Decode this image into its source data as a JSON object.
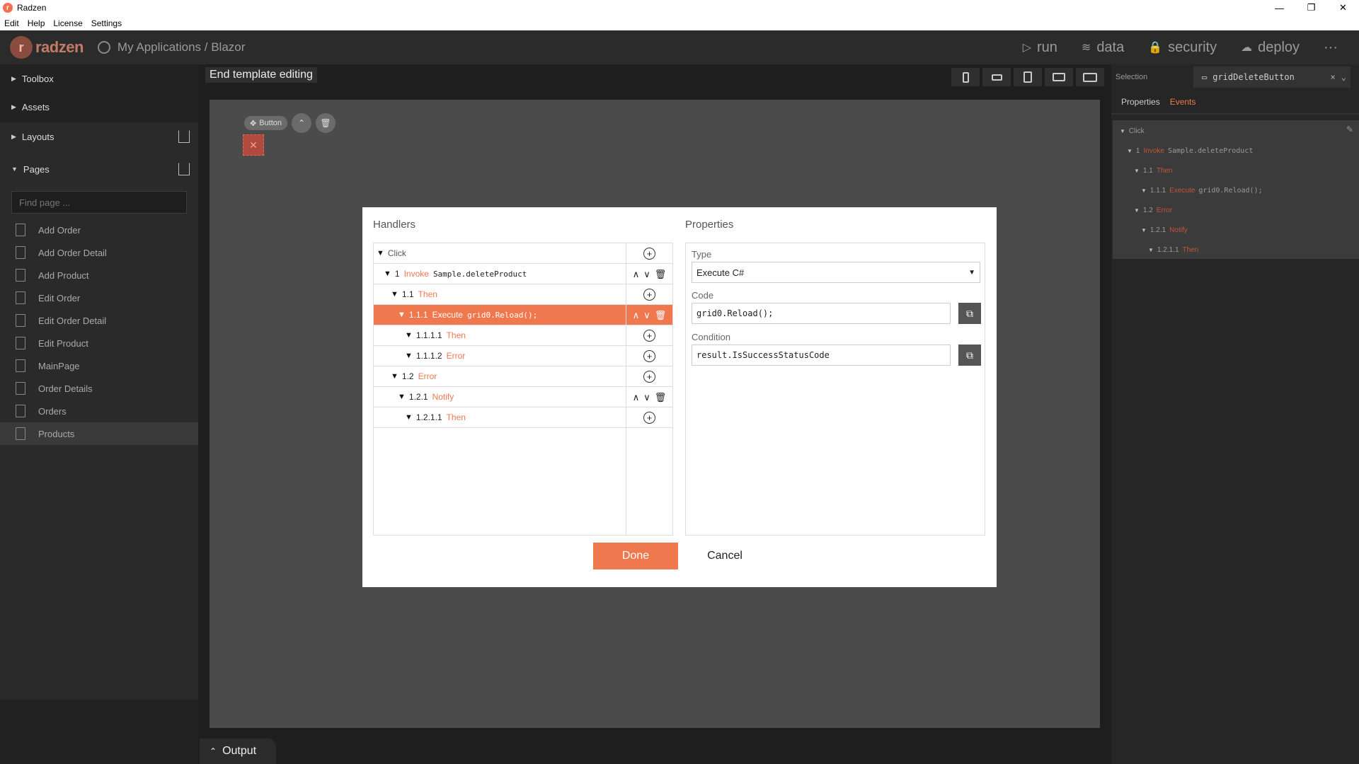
{
  "window": {
    "title": "Radzen",
    "minimize": "—",
    "restore": "❐",
    "close": "✕"
  },
  "menu": [
    "Edit",
    "Help",
    "License",
    "Settings"
  ],
  "topbar": {
    "brand": "radzen",
    "breadcrumb": "My Applications / Blazor",
    "nav": [
      {
        "icon": "▷",
        "label": "run"
      },
      {
        "icon": "≋",
        "label": "data"
      },
      {
        "icon": "🔒",
        "label": "security"
      },
      {
        "icon": "☁",
        "label": "deploy"
      },
      {
        "icon": "",
        "label": "···"
      }
    ]
  },
  "sidebar": {
    "sections": [
      "Toolbox",
      "Assets",
      "Layouts",
      "Pages"
    ],
    "find_placeholder": "Find page ...",
    "pages": [
      "Add Order",
      "Add Order Detail",
      "Add Product",
      "Edit Order",
      "Edit Order Detail",
      "Edit Product",
      "MainPage",
      "Order Details",
      "Orders",
      "Products"
    ],
    "active_page": "Products"
  },
  "canvas": {
    "end_template": "End template editing",
    "button_pill": "Button",
    "output_label": "Output"
  },
  "right_panel": {
    "selection_label": "Selection",
    "selection_value": "gridDeleteButton",
    "tabs": [
      "Properties",
      "Events"
    ],
    "tree": [
      {
        "num": "",
        "kw": "",
        "text": "Click"
      },
      {
        "num": "1",
        "kw": "Invoke",
        "text": "Sample.deleteProduct"
      },
      {
        "num": "1.1",
        "kw": "Then",
        "text": ""
      },
      {
        "num": "1.1.1",
        "kw": "Execute",
        "text": "grid0.Reload();"
      },
      {
        "num": "1.2",
        "kw": "Error",
        "text": ""
      },
      {
        "num": "1.2.1",
        "kw": "Notify",
        "text": ""
      },
      {
        "num": "1.2.1.1",
        "kw": "Then",
        "text": ""
      }
    ]
  },
  "modal": {
    "handlers_title": "Handlers",
    "properties_title": "Properties",
    "handlers": [
      {
        "num": "",
        "kw": "",
        "text": "Click",
        "acts": "plus"
      },
      {
        "num": "1",
        "kw": "Invoke",
        "text": "Sample.deleteProduct",
        "acts": "move"
      },
      {
        "num": "1.1",
        "kw": "Then",
        "text": "",
        "acts": "plus"
      },
      {
        "num": "1.1.1",
        "kw": "Execute",
        "text": "grid0.Reload();",
        "acts": "move"
      },
      {
        "num": "1.1.1.1",
        "kw": "Then",
        "text": "",
        "acts": "plus"
      },
      {
        "num": "1.1.1.2",
        "kw": "Error",
        "text": "",
        "acts": "plus"
      },
      {
        "num": "1.2",
        "kw": "Error",
        "text": "",
        "acts": "plus"
      },
      {
        "num": "1.2.1",
        "kw": "Notify",
        "text": "",
        "acts": "move"
      },
      {
        "num": "1.2.1.1",
        "kw": "Then",
        "text": "",
        "acts": "plus"
      }
    ],
    "props": {
      "type_label": "Type",
      "type_value": "Execute C#",
      "code_label": "Code",
      "code_value": "grid0.Reload();",
      "condition_label": "Condition",
      "condition_value": "result.IsSuccessStatusCode"
    },
    "done": "Done",
    "cancel": "Cancel"
  },
  "colors": {
    "accent": "#f0784e",
    "bg": "#1e1e1e"
  }
}
